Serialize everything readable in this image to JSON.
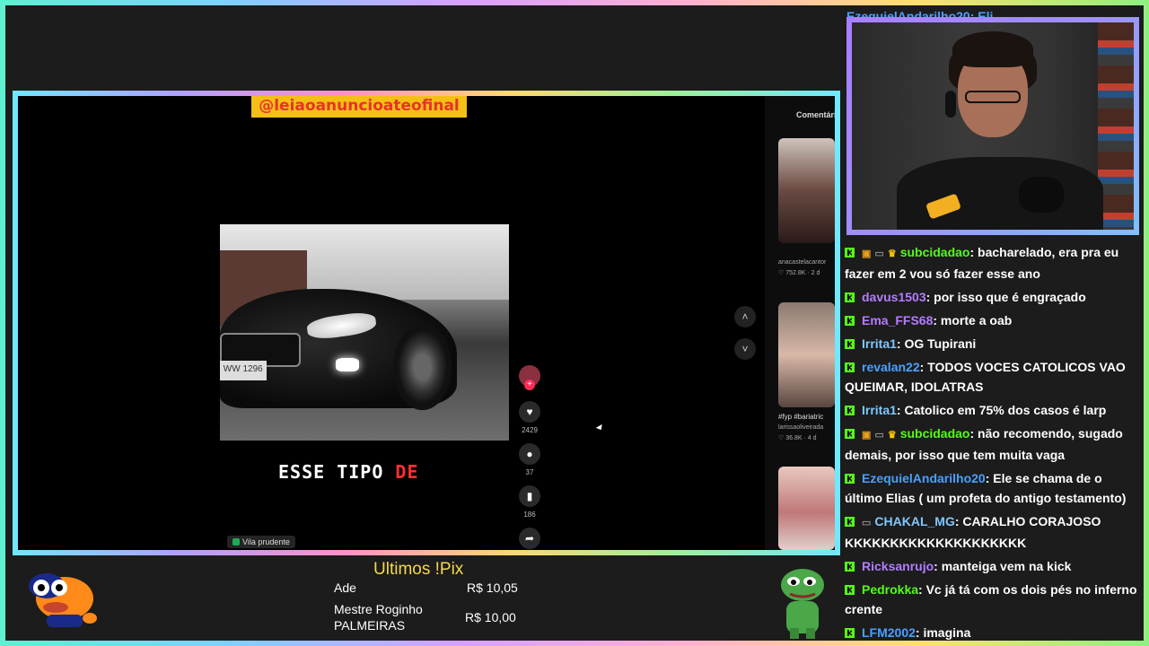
{
  "video": {
    "handle_banner": "@leiaoanuncioateofinal",
    "caption_white": "ESSE TIPO",
    "caption_red": "DE",
    "location": "Vila prudente",
    "plate": "WW 1296",
    "likes": "2429",
    "comments": "37",
    "saves": "186",
    "nav_up_icon": "chevron-up-icon",
    "nav_down_icon": "chevron-down-icon"
  },
  "side_panel": {
    "comments_tab": "Comentári",
    "thumbs": [
      {
        "author": "anacastelacantor",
        "likes": "♡ 752.8K · 2 d"
      },
      {
        "caption": "#fyp #bariatric",
        "author": "larissaoliveirada",
        "likes": "♡ 36.8K · 4 d"
      }
    ]
  },
  "pix": {
    "title": "Ultimos !Pix",
    "entries": [
      {
        "name": "Ade",
        "amount": "R$ 10,05"
      },
      {
        "name": "Mestre Roginho PALMEIRAS",
        "name_line1": "Mestre Roginho",
        "name_line2": "PALMEIRAS",
        "amount": "R$ 10,00"
      }
    ]
  },
  "chat": {
    "partial_top": "EzequielAndarilho20: Eli",
    "messages": [
      {
        "user": "subcidadao",
        "user_color": "#53fc18",
        "badges": [
          "box",
          "sub",
          "crown"
        ],
        "text": ": bacharelado, era pra eu fazer em 2 vou só fazer esse ano"
      },
      {
        "user": "davus1503",
        "user_color": "#b47cff",
        "badges": [],
        "text": ": por isso que é engraçado"
      },
      {
        "user": "Ema_FFS68",
        "user_color": "#b47cff",
        "badges": [],
        "text": ": morte a oab"
      },
      {
        "user": "Irrita1",
        "user_color": "#7fc8ff",
        "badges": [],
        "text": ": OG Tupirani"
      },
      {
        "user": "revalan22",
        "user_color": "#4aa0ff",
        "badges": [],
        "text": ": TODOS VOCES CATOLICOS VAO QUEIMAR, IDOLATRAS"
      },
      {
        "user": "Irrita1",
        "user_color": "#7fc8ff",
        "badges": [],
        "text": ": Catolico em 75% dos casos é larp"
      },
      {
        "user": "subcidadao",
        "user_color": "#53fc18",
        "badges": [
          "box",
          "sub",
          "crown"
        ],
        "text": ": não recomendo, sugado demais, por isso que tem muita vaga"
      },
      {
        "user": "EzequielAndarilho20",
        "user_color": "#4aa0ff",
        "badges": [],
        "text": ": Ele se chama de o último Elias ( um profeta do antigo testamento)"
      },
      {
        "user": "CHAKAL_MG",
        "user_color": "#7fc8ff",
        "badges": [
          "sub"
        ],
        "text": ": CARALHO CORAJOSO KKKKKKKKKKKKKKKKKKKK"
      },
      {
        "user": "Ricksanrujo",
        "user_color": "#b47cff",
        "badges": [],
        "text": ": manteiga vem na kick"
      },
      {
        "user": "Pedrokka",
        "user_color": "#53fc18",
        "badges": [],
        "text": ": Vc já tá com os dois pés no inferno crente"
      },
      {
        "user": "LFM2002",
        "user_color": "#4aa0ff",
        "badges": [],
        "text": ": imagina"
      }
    ]
  },
  "colors": {
    "accent_yellow": "#f6d84a",
    "kick_green": "#53fc18",
    "tiktok_red": "#fe2c55"
  }
}
